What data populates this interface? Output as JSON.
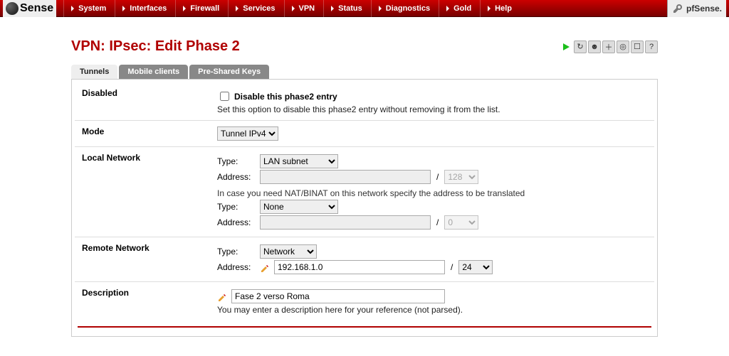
{
  "logo_text": "Sense",
  "right_badge": "pfSense.",
  "nav": [
    "System",
    "Interfaces",
    "Firewall",
    "Services",
    "VPN",
    "Status",
    "Diagnostics",
    "Gold",
    "Help"
  ],
  "page_title": "VPN: IPsec: Edit Phase 2",
  "tabs": [
    {
      "label": "Tunnels",
      "active": true
    },
    {
      "label": "Mobile clients",
      "active": false
    },
    {
      "label": "Pre-Shared Keys",
      "active": false
    }
  ],
  "disabled": {
    "label": "Disabled",
    "checkbox_label": "Disable this phase2 entry",
    "help": "Set this option to disable this phase2 entry without removing it from the list.",
    "checked": false
  },
  "mode": {
    "label": "Mode",
    "value": "Tunnel IPv4"
  },
  "local": {
    "label": "Local Network",
    "type_label": "Type:",
    "type_value": "LAN subnet",
    "address_label": "Address:",
    "address_value": "",
    "cidr_value": "128",
    "nat_note": "In case you need NAT/BINAT on this network specify the address to be translated",
    "nat_type_label": "Type:",
    "nat_type_value": "None",
    "nat_address_label": "Address:",
    "nat_address_value": "",
    "nat_cidr_value": "0"
  },
  "remote": {
    "label": "Remote Network",
    "type_label": "Type:",
    "type_value": "Network",
    "address_label": "Address:",
    "address_value": "192.168.1.0",
    "cidr_value": "24"
  },
  "description": {
    "label": "Description",
    "value": "Fase 2 verso Roma",
    "help": "You may enter a description here for your reference (not parsed)."
  },
  "action_icons": [
    "play",
    "recycle",
    "head",
    "plus",
    "target",
    "square",
    "help"
  ]
}
